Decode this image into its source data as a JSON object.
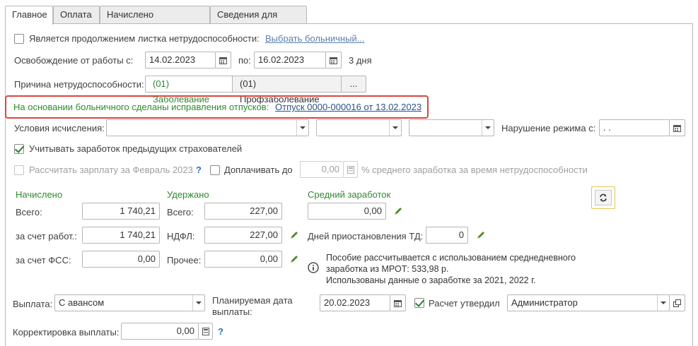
{
  "tabs": [
    {
      "label": "Главное",
      "active": true
    },
    {
      "label": "Оплата",
      "active": false
    },
    {
      "label": "Начислено (подробно)",
      "active": false
    },
    {
      "label": "Сведения для ФСС",
      "active": false
    }
  ],
  "continuation": {
    "label": "Является продолжением листка нетрудоспособности:",
    "link": "Выбрать больничный...",
    "checked": false
  },
  "release": {
    "label": "Освобождение от работы с:",
    "from": "14.02.2023",
    "to_label": "по:",
    "to": "16.02.2023",
    "days": "3 дня"
  },
  "reason": {
    "label": "Причина нетрудоспособности:",
    "options": [
      "(01) Заболевание",
      "(01) Профзаболевание"
    ],
    "more": "...",
    "selected": "(01) Заболевание"
  },
  "notice": {
    "text": "На основании больничного сделаны исправления отпусков:",
    "link": "Отпуск 0000-000016 от 13.02.2023",
    "highlight_color": "#d9463e"
  },
  "conditions": {
    "label": "Условия исчисления:",
    "value1": "",
    "value2": "",
    "value3": "",
    "violation_label": "Нарушение режима с:",
    "violation_value": " .  . "
  },
  "prev_insurers": {
    "label": "Учитывать заработок предыдущих страхователей",
    "checked": true
  },
  "salary_calc": {
    "label": "Рассчитать зарплату за Февраль 2023",
    "help": "?",
    "checked": false,
    "disabled": true
  },
  "topup": {
    "label": "Доплачивать до",
    "value": "0,00",
    "suffix": "% среднего заработка за время нетрудоспособности",
    "checked": false
  },
  "accrued": {
    "title": "Начислено",
    "total_label": "Всего:",
    "total": "1 740,21",
    "employer_label": "за счет работ.:",
    "employer": "1 740,21",
    "fss_label": "за счет ФСС:",
    "fss": "0,00"
  },
  "withheld": {
    "title": "Удержано",
    "total_label": "Всего:",
    "total": "227,00",
    "ndfl_label": "НДФЛ:",
    "ndfl": "227,00",
    "other_label": "Прочее:",
    "other": "0,00"
  },
  "average": {
    "title": "Средний заработок",
    "value": "0,00",
    "suspension_label": "Дней приостановления ТД:",
    "suspension": "0"
  },
  "info": {
    "lines": [
      "Пособие рассчитывается с использованием среднедневного",
      "заработка из МРОТ: 533,98 р.",
      "Использованы данные о заработке за  2021,  2022 г."
    ]
  },
  "payment": {
    "label": "Выплата:",
    "value": "С авансом",
    "planned_label_1": "Планируемая дата",
    "planned_label_2": "выплаты:",
    "planned_date": "20.02.2023",
    "approved_label": "Расчет утвердил",
    "approved_checked": true,
    "approved_by": "Администратор"
  },
  "correction": {
    "label": "Корректировка выплаты:",
    "value": "0,00",
    "help": "?"
  },
  "colors": {
    "accent_green": "#2e8b2e",
    "link_blue": "#29528a",
    "highlight_red": "#d9463e",
    "pencil_green": "#4c8c2b"
  }
}
